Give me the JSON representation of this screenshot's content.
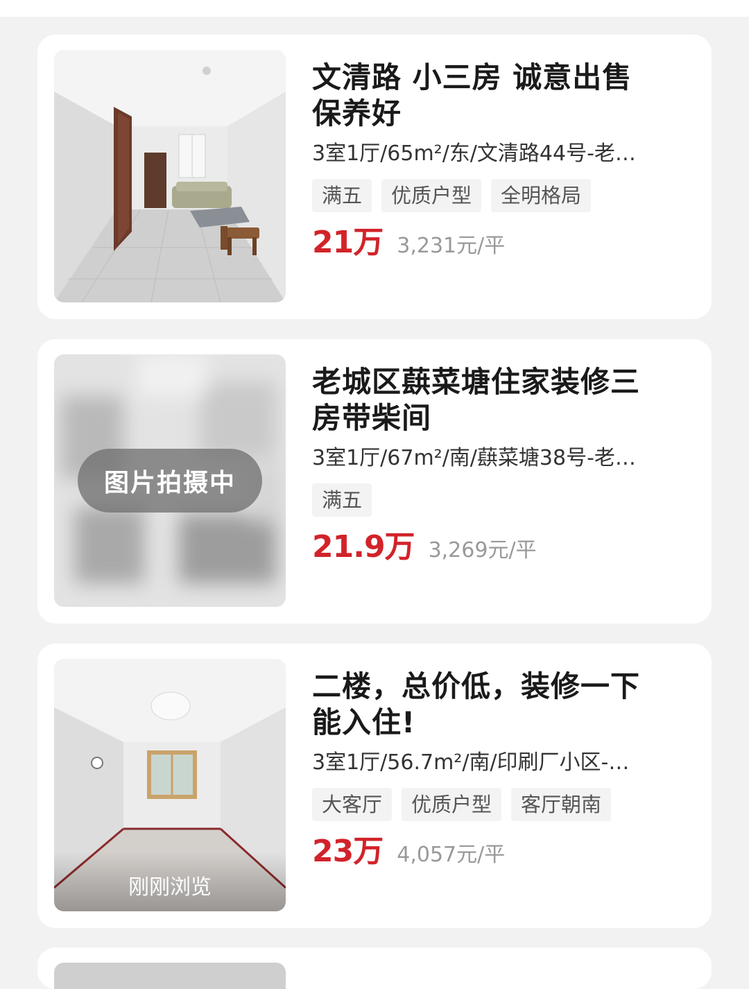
{
  "listings": [
    {
      "title_line1": "文清路 小三房 诚意出售",
      "title_line2": "保养好",
      "meta": "3室1厅/65m²/东/文清路44号-老…",
      "tags": [
        "满五",
        "优质户型",
        "全明格局"
      ],
      "price": "21万",
      "unit_price": "3,231元/平"
    },
    {
      "title_line1": "老城区蕻菜塘住家装修三",
      "title_line2": "房带柴间",
      "meta": "3室1厅/67m²/南/蕻菜塘38号-老…",
      "tags": [
        "满五"
      ],
      "price": "21.9万",
      "unit_price": "3,269元/平",
      "photo_overlay": "图片拍摄中"
    },
    {
      "title_line1": "二楼，总价低，装修一下",
      "title_line2": "能入住!",
      "meta": "3室1厅/56.7m²/南/印刷厂小区-…",
      "tags": [
        "大客厅",
        "优质户型",
        "客厅朝南"
      ],
      "price": "23万",
      "unit_price": "4,057元/平",
      "photo_label": "刚刚浏览"
    }
  ],
  "colors": {
    "price": "#d2232a",
    "background": "#f2f2f2",
    "card": "#ffffff",
    "tag_bg": "#f3f3f3"
  }
}
